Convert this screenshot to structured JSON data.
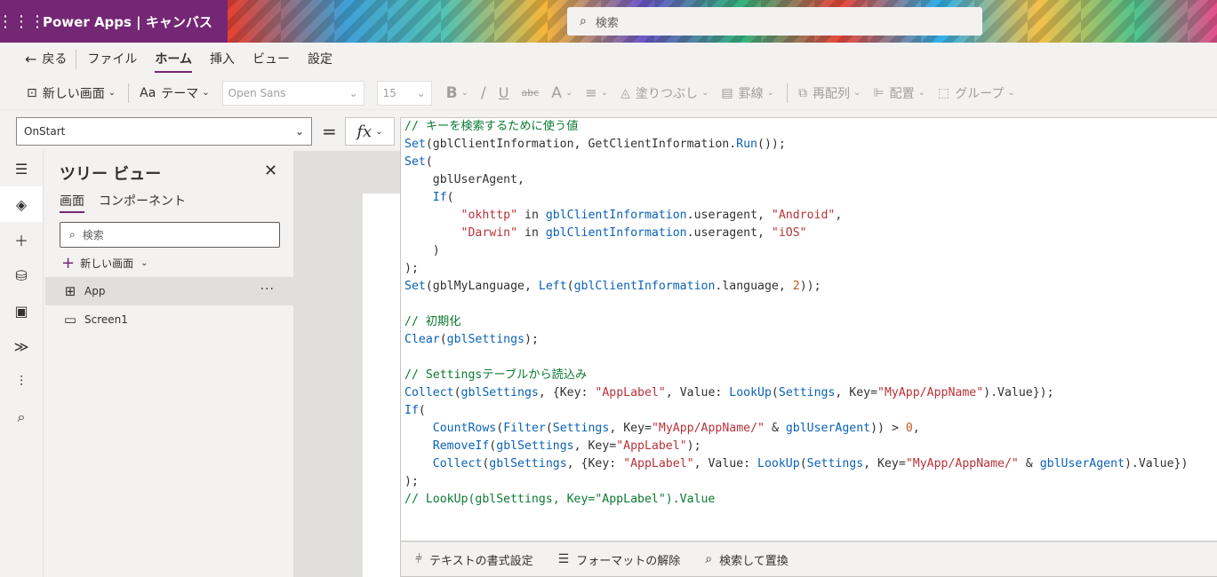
{
  "app": {
    "brand": "Power Apps  |  キャンバス"
  },
  "top_search": {
    "placeholder": "検索"
  },
  "menu": {
    "back": "戻る",
    "items": [
      "ファイル",
      "ホーム",
      "挿入",
      "ビュー",
      "設定"
    ],
    "active": "ホーム"
  },
  "ribbon": {
    "new_screen": "新しい画面",
    "theme": "テーマ",
    "font": "Open Sans",
    "font_size": "15",
    "bold": "B",
    "italic": "/",
    "underline": "U",
    "strike": "abc",
    "font_color": "A",
    "align": "≡",
    "fill": "塗りつぶし",
    "border": "罫線",
    "reorder": "再配列",
    "arrange": "配置",
    "group": "グループ"
  },
  "property_bar": {
    "property": "OnStart",
    "equals": "=",
    "fx": "fx"
  },
  "tree": {
    "title": "ツリー ビュー",
    "tabs": [
      "画面",
      "コンポーネント"
    ],
    "search_placeholder": "検索",
    "new_screen": "新しい画面",
    "nodes": [
      {
        "label": "App",
        "icon": "app-icon",
        "selected": true
      },
      {
        "label": "Screen1",
        "icon": "screen-icon",
        "selected": false
      }
    ]
  },
  "code_lines": [
    [
      [
        "c-cmt",
        "// キーを検索するために使う値"
      ]
    ],
    [
      [
        "c-fn",
        "Set"
      ],
      [
        "",
        "(gblClientInformation, GetClientInformation."
      ],
      [
        "c-fn",
        "Run"
      ],
      [
        "",
        "());"
      ]
    ],
    [
      [
        "c-fn",
        "Set"
      ],
      [
        "",
        "("
      ]
    ],
    [
      [
        "",
        "    gblUserAgent,"
      ]
    ],
    [
      [
        "",
        "    "
      ],
      [
        "c-fn",
        "If"
      ],
      [
        "",
        "("
      ]
    ],
    [
      [
        "",
        "        "
      ],
      [
        "c-str",
        "\"okhttp\""
      ],
      [
        "",
        " in "
      ],
      [
        "c-fn",
        "gblClientInformation"
      ],
      [
        "",
        ".useragent, "
      ],
      [
        "c-str",
        "\"Android\""
      ],
      [
        "",
        ","
      ]
    ],
    [
      [
        "",
        "        "
      ],
      [
        "c-str",
        "\"Darwin\""
      ],
      [
        "",
        " in "
      ],
      [
        "c-fn",
        "gblClientInformation"
      ],
      [
        "",
        ".useragent, "
      ],
      [
        "c-str",
        "\"iOS\""
      ]
    ],
    [
      [
        "",
        "    )"
      ]
    ],
    [
      [
        "",
        ");"
      ]
    ],
    [
      [
        "c-fn",
        "Set"
      ],
      [
        "",
        "(gblMyLanguage, "
      ],
      [
        "c-fn",
        "Left"
      ],
      [
        "",
        "("
      ],
      [
        "c-fn",
        "gblClientInformation"
      ],
      [
        "",
        ".language, "
      ],
      [
        "c-num",
        "2"
      ],
      [
        "",
        "));"
      ]
    ],
    [
      [
        "",
        ""
      ]
    ],
    [
      [
        "c-cmt",
        "// 初期化"
      ]
    ],
    [
      [
        "c-fn",
        "Clear"
      ],
      [
        "",
        "("
      ],
      [
        "c-fn",
        "gblSettings"
      ],
      [
        "",
        ");"
      ]
    ],
    [
      [
        "",
        ""
      ]
    ],
    [
      [
        "c-cmt",
        "// Settingsテーブルから読込み"
      ]
    ],
    [
      [
        "c-fn",
        "Collect"
      ],
      [
        "",
        "("
      ],
      [
        "c-fn",
        "gblSettings"
      ],
      [
        "",
        ", {Key: "
      ],
      [
        "c-str",
        "\"AppLabel\""
      ],
      [
        "",
        ", Value: "
      ],
      [
        "c-fn",
        "LookUp"
      ],
      [
        "",
        "("
      ],
      [
        "c-fn",
        "Settings"
      ],
      [
        "",
        ", Key="
      ],
      [
        "c-str",
        "\"MyApp/AppName\""
      ],
      [
        "",
        ").Value});"
      ]
    ],
    [
      [
        "c-fn",
        "If"
      ],
      [
        "",
        "("
      ]
    ],
    [
      [
        "",
        "    "
      ],
      [
        "c-fn",
        "CountRows"
      ],
      [
        "",
        "("
      ],
      [
        "c-fn",
        "Filter"
      ],
      [
        "",
        "("
      ],
      [
        "c-fn",
        "Settings"
      ],
      [
        "",
        ", Key="
      ],
      [
        "c-str",
        "\"MyApp/AppName/\""
      ],
      [
        "",
        " & "
      ],
      [
        "c-fn",
        "gblUserAgent"
      ],
      [
        "",
        "))"
      ],
      [
        "",
        " > "
      ],
      [
        "c-num",
        "0"
      ],
      [
        "",
        ","
      ]
    ],
    [
      [
        "",
        "    "
      ],
      [
        "c-fn",
        "RemoveIf"
      ],
      [
        "",
        "("
      ],
      [
        "c-fn",
        "gblSettings"
      ],
      [
        "",
        ", Key="
      ],
      [
        "c-str",
        "\"AppLabel\""
      ],
      [
        "",
        ");"
      ]
    ],
    [
      [
        "",
        "    "
      ],
      [
        "c-fn",
        "Collect"
      ],
      [
        "",
        "("
      ],
      [
        "c-fn",
        "gblSettings"
      ],
      [
        "",
        ", {Key: "
      ],
      [
        "c-str",
        "\"AppLabel\""
      ],
      [
        "",
        ", Value: "
      ],
      [
        "c-fn",
        "LookUp"
      ],
      [
        "",
        "("
      ],
      [
        "c-fn",
        "Settings"
      ],
      [
        "",
        ", Key="
      ],
      [
        "c-str",
        "\"MyApp/AppName/\""
      ],
      [
        "",
        " & "
      ],
      [
        "c-fn",
        "gblUserAgent"
      ],
      [
        "",
        ").Value})"
      ]
    ],
    [
      [
        "",
        ");"
      ]
    ],
    [
      [
        "c-cmt",
        "// LookUp(gblSettings, Key=\"AppLabel\").Value"
      ]
    ]
  ],
  "footer": {
    "format_text": "テキストの書式設定",
    "remove_format": "フォーマットの解除",
    "find_replace": "検索して置換"
  },
  "colors": {
    "brand": "#742774",
    "comment": "#0b7a33",
    "function": "#0b62b8",
    "string": "#b8323a",
    "number": "#c0571a"
  }
}
